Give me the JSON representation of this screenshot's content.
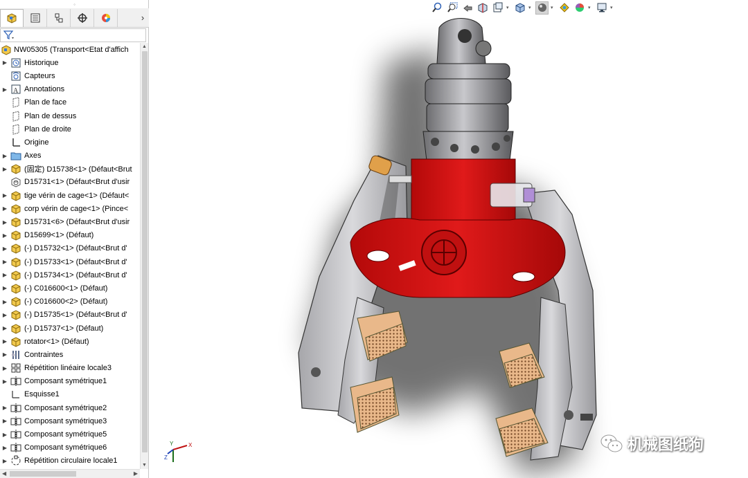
{
  "panel": {
    "tabs": [
      {
        "icon": "featuremanager-tree-icon",
        "active": true
      },
      {
        "icon": "propertymanager-icon",
        "active": false
      },
      {
        "icon": "configurationmanager-icon",
        "active": false
      },
      {
        "icon": "dimxpertmanager-icon",
        "active": false
      },
      {
        "icon": "displaymanager-icon",
        "active": false
      }
    ],
    "more_tabs": "›",
    "filter_icon": "filter-icon",
    "root": {
      "label": "NW05305  (Transport<Etat d'affich",
      "icon": "assembly-icon"
    },
    "items": [
      {
        "label": "Historique",
        "icon": "history-icon",
        "expandable": true
      },
      {
        "label": "Capteurs",
        "icon": "sensor-icon",
        "expandable": false
      },
      {
        "label": "Annotations",
        "icon": "annotations-icon",
        "expandable": true
      },
      {
        "label": "Plan de face",
        "icon": "plane-icon",
        "expandable": false
      },
      {
        "label": "Plan de dessus",
        "icon": "plane-icon",
        "expandable": false
      },
      {
        "label": "Plan de droite",
        "icon": "plane-icon",
        "expandable": false
      },
      {
        "label": "Origine",
        "icon": "origin-icon",
        "expandable": false
      },
      {
        "label": "Axes",
        "icon": "folder-icon",
        "expandable": true
      },
      {
        "label": "(固定) D15738<1> (Défaut<Brut",
        "icon": "part-icon",
        "expandable": true
      },
      {
        "label": "D15731<1> (Défaut<Brut d'usir",
        "icon": "part-edit-icon",
        "expandable": false
      },
      {
        "label": "tige vérin de cage<1> (Défaut<",
        "icon": "part-icon",
        "expandable": true
      },
      {
        "label": "corp vérin de cage<1> (Pince<",
        "icon": "part-icon",
        "expandable": true
      },
      {
        "label": "D15731<6> (Défaut<Brut d'usir",
        "icon": "part-icon",
        "expandable": true
      },
      {
        "label": "D15699<1> (Défaut)",
        "icon": "part-icon",
        "expandable": true
      },
      {
        "label": "(-) D15732<1> (Défaut<Brut d'",
        "icon": "part-icon",
        "expandable": true
      },
      {
        "label": "(-) D15733<1> (Défaut<Brut d'",
        "icon": "part-icon",
        "expandable": true
      },
      {
        "label": "(-) D15734<1> (Défaut<Brut d'",
        "icon": "part-icon",
        "expandable": true
      },
      {
        "label": "(-) C016600<1> (Défaut)",
        "icon": "part-icon",
        "expandable": true
      },
      {
        "label": "(-) C016600<2> (Défaut)",
        "icon": "part-icon",
        "expandable": true
      },
      {
        "label": "(-) D15735<1> (Défaut<Brut d'",
        "icon": "part-icon",
        "expandable": true
      },
      {
        "label": "(-) D15737<1> (Défaut)",
        "icon": "part-icon",
        "expandable": true
      },
      {
        "label": "rotator<1> (Défaut)",
        "icon": "part-icon",
        "expandable": true
      },
      {
        "label": "Contraintes",
        "icon": "mates-icon",
        "expandable": true
      },
      {
        "label": "Répétition linéaire locale3",
        "icon": "linear-pattern-icon",
        "expandable": true
      },
      {
        "label": "Composant symétrique1",
        "icon": "mirror-component-icon",
        "expandable": true
      },
      {
        "label": "Esquisse1",
        "icon": "sketch-icon",
        "expandable": false
      },
      {
        "label": "Composant symétrique2",
        "icon": "mirror-component-icon",
        "expandable": true
      },
      {
        "label": "Composant symétrique3",
        "icon": "mirror-component-icon",
        "expandable": true
      },
      {
        "label": "Composant symétrique5",
        "icon": "mirror-component-icon",
        "expandable": true
      },
      {
        "label": "Composant symétrique6",
        "icon": "mirror-component-icon",
        "expandable": true
      },
      {
        "label": "Répétition circulaire locale1",
        "icon": "circular-pattern-icon",
        "expandable": true
      }
    ]
  },
  "hud_toolbar": [
    "zoom-to-fit-icon",
    "zoom-to-area-icon",
    "previous-view-icon",
    "section-view-icon",
    "dynamic-annotation-icon",
    "view-orientation-icon",
    "display-style-icon",
    "hide-show-items-icon",
    "edit-appearance-icon",
    "apply-scene-icon",
    "view-settings-icon"
  ],
  "triad": {
    "x_label": "X",
    "y_label": "Y",
    "z_label": "Z"
  },
  "watermark": {
    "text": "机械图纸狗"
  },
  "colors": {
    "frame_red": "#d10f0f",
    "jaw_grey": "#c9c9cc",
    "pad_tan": "#e9b88a"
  }
}
